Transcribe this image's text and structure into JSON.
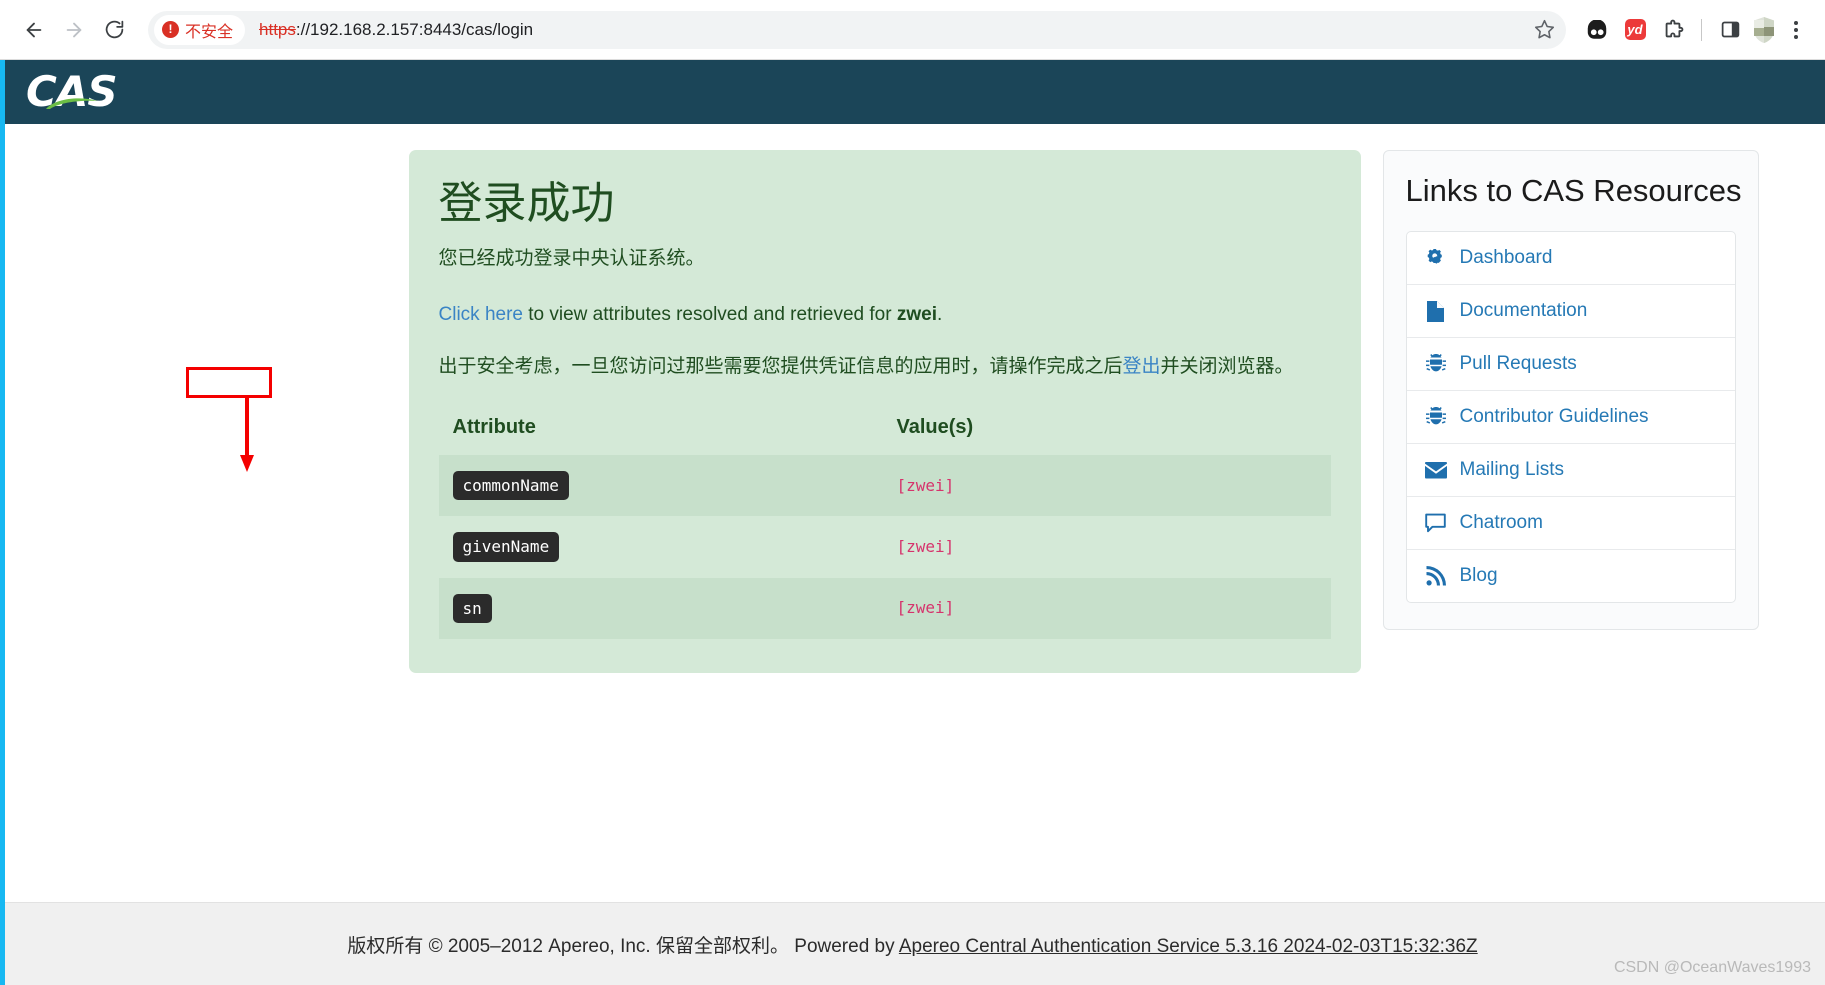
{
  "browser": {
    "back_label": "Back",
    "forward_label": "Forward",
    "reload_label": "Reload",
    "security_badge": "不安全",
    "url_scheme": "https",
    "url_rest": "://192.168.2.157:8443/cas/login",
    "bookmark_label": "Bookmark this tab",
    "extensions": [
      {
        "name": "panda-extension-icon",
        "label": ""
      },
      {
        "name": "youdao-extension-icon",
        "label": "yd"
      },
      {
        "name": "extensions-puzzle-icon",
        "label": "Extensions"
      }
    ],
    "side_panel_label": "Side panel",
    "profile_label": "Profile",
    "menu_label": "Customize and control Google Chrome"
  },
  "site_header": {
    "logo_text": "CAS"
  },
  "success": {
    "title": "登录成功",
    "subtitle": "您已经成功登录中央认证系统。",
    "click_link": "Click here",
    "attr_sentence_before": " to view attributes resolved and retrieved for ",
    "principal": "zwei",
    "attr_sentence_after": ".",
    "security_note_before": "出于安全考虑，一旦您访问过那些需要您提供凭证信息的应用时，请操作完成之后",
    "logout_link": "登出",
    "security_note_after": "并关闭浏览器。"
  },
  "attributes_table": {
    "headers": [
      "Attribute",
      "Value(s)"
    ],
    "rows": [
      {
        "name": "commonName",
        "value": "[zwei]"
      },
      {
        "name": "givenName",
        "value": "[zwei]"
      },
      {
        "name": "sn",
        "value": "[zwei]"
      }
    ]
  },
  "sidebar": {
    "title": "Links to CAS Resources",
    "items": [
      {
        "label": "Dashboard",
        "icon": "cogs-icon"
      },
      {
        "label": "Documentation",
        "icon": "file-icon"
      },
      {
        "label": "Pull Requests",
        "icon": "bug-icon"
      },
      {
        "label": "Contributor Guidelines",
        "icon": "bug-icon"
      },
      {
        "label": "Mailing Lists",
        "icon": "envelope-icon"
      },
      {
        "label": "Chatroom",
        "icon": "comment-icon"
      },
      {
        "label": "Blog",
        "icon": "rss-icon"
      }
    ]
  },
  "footer": {
    "copyright": "版权所有 © 2005–2012 Apereo, Inc. 保留全部权利。",
    "powered_by": "Powered by ",
    "product_link": "Apereo Central Authentication Service 5.3.16 2024-02-03T15:32:36Z"
  },
  "watermark": "CSDN @OceanWaves1993",
  "colors": {
    "header_bg": "#1b4558",
    "success_bg": "#d4e9d7",
    "success_text": "#1f4d20",
    "link_blue": "#2579b5",
    "value_pink": "#d6336c",
    "annotation_red": "#f40000"
  }
}
